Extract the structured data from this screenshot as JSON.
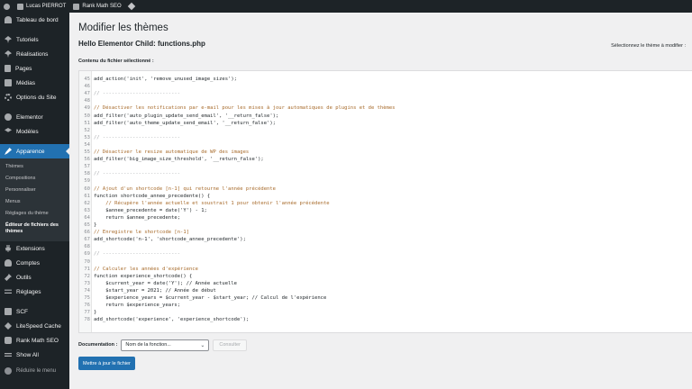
{
  "adminbar": {
    "user_label": "Lucas PIERROT",
    "seo_label": "Rank Math SEO"
  },
  "sidebar": {
    "items_top": [
      {
        "label": "Tableau de bord",
        "icon": "dashboard-icon"
      }
    ],
    "items_main": [
      {
        "label": "Tutoriels",
        "icon": "pin-icon"
      },
      {
        "label": "Réalisations",
        "icon": "pin-icon"
      },
      {
        "label": "Pages",
        "icon": "pages-icon"
      },
      {
        "label": "Médias",
        "icon": "media-icon"
      },
      {
        "label": "Options du Site",
        "icon": "gear-icon"
      }
    ],
    "items_elementor": [
      {
        "label": "Elementor",
        "icon": "elementor-icon"
      },
      {
        "label": "Modèles",
        "icon": "templates-icon"
      }
    ],
    "active_item": {
      "label": "Apparence",
      "icon": "paintbrush-icon"
    },
    "submenu": [
      "Thèmes",
      "Compositions",
      "Personnaliser",
      "Menus",
      "Réglages du thème",
      "Éditeur de fichiers des thèmes"
    ],
    "items_after": [
      {
        "label": "Extensions",
        "icon": "plugins-icon"
      },
      {
        "label": "Comptes",
        "icon": "users-icon"
      },
      {
        "label": "Outils",
        "icon": "tools-icon"
      },
      {
        "label": "Réglages",
        "icon": "settings-icon"
      }
    ],
    "items_plugins": [
      {
        "label": "SCF",
        "icon": "scf-icon"
      },
      {
        "label": "LiteSpeed Cache",
        "icon": "litespeed-icon"
      },
      {
        "label": "Rank Math SEO",
        "icon": "rankmath-icon"
      },
      {
        "label": "Show All",
        "icon": "list-icon"
      }
    ],
    "collapse_label": "Réduire le menu"
  },
  "main": {
    "page_title": "Modifier les thèmes",
    "file_title": "Hello Elementor Child: functions.php",
    "theme_select_label": "Sélectionnez le thème à modifier :",
    "content_label": "Contenu du fichier sélectionné :",
    "code_lines": [
      {
        "num": "45",
        "text": "add_action('init', 'remove_unused_image_sizes');",
        "kind": "code"
      },
      {
        "num": "46",
        "text": "",
        "kind": "code"
      },
      {
        "num": "47",
        "text": "// --------------------------",
        "kind": "dashes"
      },
      {
        "num": "48",
        "text": "",
        "kind": "code"
      },
      {
        "num": "49",
        "text": "// Désactiver les notifications par e-mail pour les mises à jour automatiques de plugins et de thèmes",
        "kind": "comment"
      },
      {
        "num": "50",
        "text": "add_filter('auto_plugin_update_send_email', '__return_false');",
        "kind": "code"
      },
      {
        "num": "51",
        "text": "add_filter('auto_theme_update_send_email', '__return_false');",
        "kind": "code"
      },
      {
        "num": "52",
        "text": "",
        "kind": "code"
      },
      {
        "num": "53",
        "text": "// --------------------------",
        "kind": "dashes"
      },
      {
        "num": "54",
        "text": "",
        "kind": "code"
      },
      {
        "num": "55",
        "text": "// Désactiver le resize automatique de WP des images",
        "kind": "comment"
      },
      {
        "num": "56",
        "text": "add_filter('big_image_size_threshold', '__return_false');",
        "kind": "code"
      },
      {
        "num": "57",
        "text": "",
        "kind": "code"
      },
      {
        "num": "58",
        "text": "// --------------------------",
        "kind": "dashes"
      },
      {
        "num": "59",
        "text": "",
        "kind": "code"
      },
      {
        "num": "60",
        "text": "// Ajout d'un shortcode [n-1] qui retourne l'année précédente",
        "kind": "comment"
      },
      {
        "num": "61",
        "text": "function shortcode_annee_precedente() {",
        "kind": "code"
      },
      {
        "num": "62",
        "text": "    // Récupère l'année actuelle et soustrait 1 pour obtenir l'année précédente",
        "kind": "comment"
      },
      {
        "num": "63",
        "text": "    $annee_precedente = date('Y') - 1;",
        "kind": "code"
      },
      {
        "num": "64",
        "text": "    return $annee_precedente;",
        "kind": "code"
      },
      {
        "num": "65",
        "text": "}",
        "kind": "code"
      },
      {
        "num": "66",
        "text": "// Enregistre le shortcode [n-1]",
        "kind": "comment"
      },
      {
        "num": "67",
        "text": "add_shortcode('n-1', 'shortcode_annee_precedente');",
        "kind": "code"
      },
      {
        "num": "68",
        "text": "",
        "kind": "code"
      },
      {
        "num": "69",
        "text": "// --------------------------",
        "kind": "dashes"
      },
      {
        "num": "70",
        "text": "",
        "kind": "code"
      },
      {
        "num": "71",
        "text": "// Calculer les années d'expérience",
        "kind": "comment"
      },
      {
        "num": "72",
        "text": "function experience_shortcode() {",
        "kind": "code"
      },
      {
        "num": "73",
        "text": "    $current_year = date('Y'); // Année actuelle",
        "kind": "code"
      },
      {
        "num": "74",
        "text": "    $start_year = 2021; // Année de début",
        "kind": "code"
      },
      {
        "num": "75",
        "text": "    $experience_years = $current_year - $start_year; // Calcul de l'expérience",
        "kind": "code"
      },
      {
        "num": "76",
        "text": "    return $experience_years;",
        "kind": "code"
      },
      {
        "num": "77",
        "text": "}",
        "kind": "code"
      },
      {
        "num": "78",
        "text": "add_shortcode('experience', 'experience_shortcode');",
        "kind": "code"
      }
    ],
    "documentation_label": "Documentation :",
    "function_select_value": "Nom de la fonction...",
    "lookup_button": "Consulter",
    "update_button": "Mettre à jour le fichier"
  },
  "colors": {
    "accent": "#2271b1",
    "sidebar_bg": "#1d2327",
    "comment": "#a76a2a"
  }
}
